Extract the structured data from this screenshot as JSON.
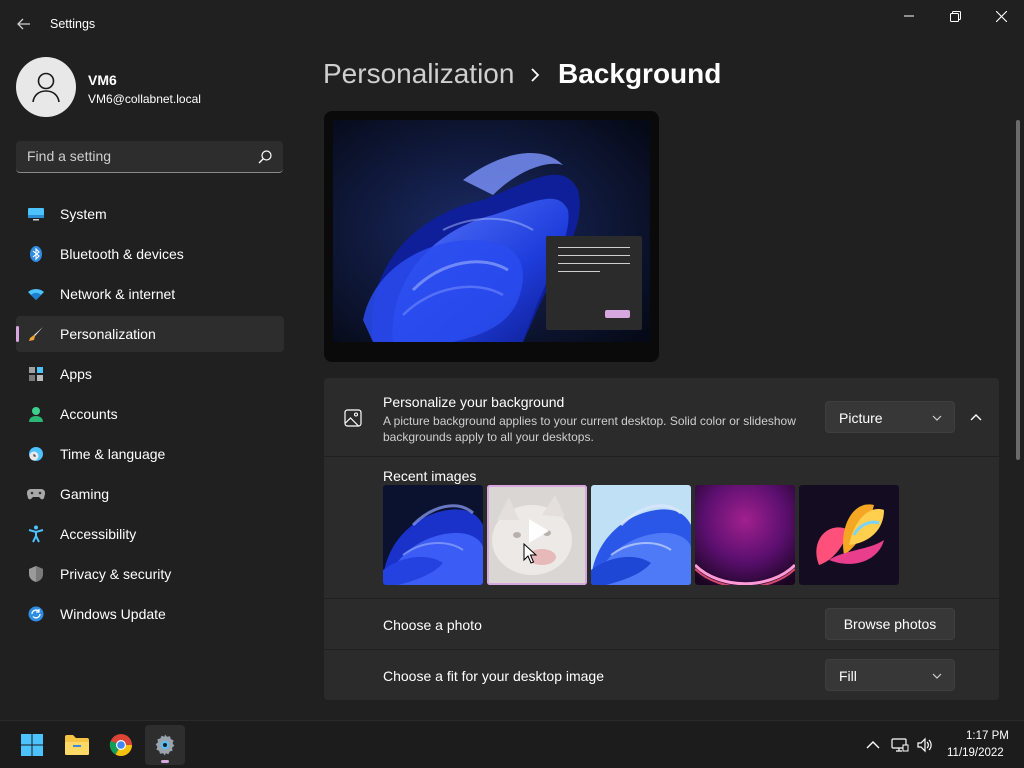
{
  "window": {
    "title": "Settings"
  },
  "user": {
    "name": "VM6",
    "email": "VM6@collabnet.local"
  },
  "search": {
    "placeholder": "Find a setting"
  },
  "sidebar": {
    "items": [
      {
        "label": "System",
        "icon": "monitor-icon"
      },
      {
        "label": "Bluetooth & devices",
        "icon": "bluetooth-icon"
      },
      {
        "label": "Network & internet",
        "icon": "wifi-icon"
      },
      {
        "label": "Personalization",
        "icon": "paintbrush-icon",
        "selected": true
      },
      {
        "label": "Apps",
        "icon": "apps-icon"
      },
      {
        "label": "Accounts",
        "icon": "person-icon"
      },
      {
        "label": "Time & language",
        "icon": "clock-globe-icon"
      },
      {
        "label": "Gaming",
        "icon": "gamepad-icon"
      },
      {
        "label": "Accessibility",
        "icon": "accessibility-icon"
      },
      {
        "label": "Privacy & security",
        "icon": "shield-icon"
      },
      {
        "label": "Windows Update",
        "icon": "update-icon"
      }
    ]
  },
  "breadcrumb": {
    "parent": "Personalization",
    "current": "Background"
  },
  "background_section": {
    "title": "Personalize your background",
    "description": "A picture background applies to your current desktop. Solid color or slideshow backgrounds apply to all your desktops.",
    "type_value": "Picture",
    "recent_images_label": "Recent images",
    "recent_images": [
      {
        "name": "blue-bloom-dark"
      },
      {
        "name": "cat-video",
        "selected": true
      },
      {
        "name": "blue-bloom-light"
      },
      {
        "name": "purple-glow"
      },
      {
        "name": "colorful-bloom"
      }
    ],
    "choose_photo_label": "Choose a photo",
    "browse_button": "Browse photos",
    "fit_label": "Choose a fit for your desktop image",
    "fit_value": "Fill"
  },
  "taskbar": {
    "apps": [
      {
        "name": "start-button"
      },
      {
        "name": "file-explorer"
      },
      {
        "name": "chrome"
      },
      {
        "name": "settings",
        "active": true
      }
    ],
    "time": "1:17 PM",
    "date": "11/19/2022"
  },
  "colors": {
    "accent": "#d7a7e0",
    "background": "#202020",
    "card": "#2b2b2b"
  }
}
